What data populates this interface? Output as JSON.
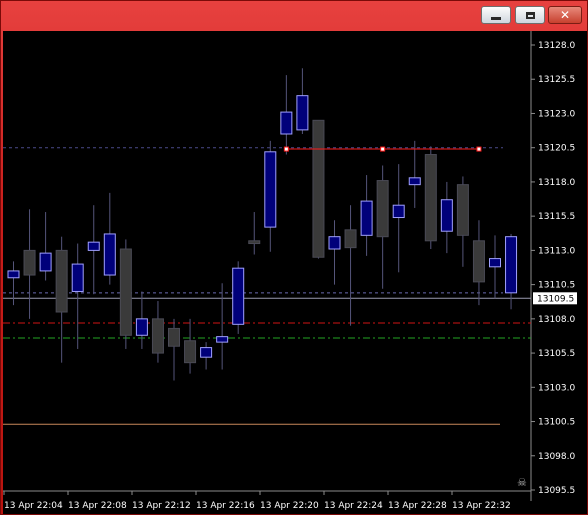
{
  "window": {
    "buttons": {
      "minimize": "minimize",
      "maximize": "maximize",
      "close": "close"
    }
  },
  "colors": {
    "background": "#000000",
    "axis": "#8c8c8c",
    "bull": "#00007a",
    "bear": "#3a3a3a",
    "wick": "#55557a",
    "ask_line": "#6a6ab0",
    "trendline": "#ff1a1a",
    "red_dash": "#d11414",
    "green_dash": "#25a325",
    "orange_line": "#c8875a"
  },
  "chart_data": {
    "type": "candlestick",
    "symbol_timeframe": "",
    "y_ticks": [
      "13128.0",
      "13125.5",
      "13123.0",
      "13120.5",
      "13118.0",
      "13115.5",
      "13113.0",
      "13110.5",
      "13108.0",
      "13105.5",
      "13103.0",
      "13100.5",
      "13098.0",
      "13095.5"
    ],
    "x_ticks": [
      "13 Apr 22:04",
      "13 Apr 22:08",
      "13 Apr 22:12",
      "13 Apr 22:16",
      "13 Apr 22:20",
      "13 Apr 22:24",
      "13 Apr 22:28",
      "13 Apr 22:32"
    ],
    "current_price_label": "13109.5",
    "ylim": [
      13095.0,
      13129.0
    ],
    "levels": {
      "bid": 13109.5,
      "ask": 13109.9,
      "upper_dotted": 13120.5,
      "red_dash": 13107.7,
      "green_dash": 13106.6,
      "orange": 13100.3
    },
    "trendline": {
      "from_index": 17,
      "to_index": 29,
      "price": 13120.4
    },
    "candles": [
      {
        "o": 13111.0,
        "h": 13112.2,
        "l": 13109.0,
        "c": 13111.5
      },
      {
        "o": 13113.0,
        "h": 13116.0,
        "l": 13108.0,
        "c": 13111.2
      },
      {
        "o": 13111.5,
        "h": 13115.8,
        "l": 13110.8,
        "c": 13112.8
      },
      {
        "o": 13113.0,
        "h": 13114.0,
        "l": 13104.8,
        "c": 13108.5
      },
      {
        "o": 13110.0,
        "h": 13113.5,
        "l": 13105.8,
        "c": 13112.0
      },
      {
        "o": 13113.0,
        "h": 13116.3,
        "l": 13109.8,
        "c": 13113.6
      },
      {
        "o": 13111.2,
        "h": 13117.2,
        "l": 13110.5,
        "c": 13114.2
      },
      {
        "o": 13113.1,
        "h": 13113.8,
        "l": 13105.8,
        "c": 13106.8
      },
      {
        "o": 13106.8,
        "h": 13110.0,
        "l": 13105.8,
        "c": 13108.0
      },
      {
        "o": 13108.0,
        "h": 13109.3,
        "l": 13104.8,
        "c": 13105.5
      },
      {
        "o": 13107.3,
        "h": 13108.0,
        "l": 13103.5,
        "c": 13106.0
      },
      {
        "o": 13106.4,
        "h": 13108.0,
        "l": 13104.0,
        "c": 13104.8
      },
      {
        "o": 13105.2,
        "h": 13106.3,
        "l": 13104.3,
        "c": 13105.9
      },
      {
        "o": 13106.3,
        "h": 13110.6,
        "l": 13104.3,
        "c": 13106.7
      },
      {
        "o": 13107.6,
        "h": 13112.2,
        "l": 13106.9,
        "c": 13111.7
      },
      {
        "o": 13113.7,
        "h": 13115.8,
        "l": 13112.7,
        "c": 13113.5
      },
      {
        "o": 13114.7,
        "h": 13121.0,
        "l": 13112.9,
        "c": 13120.2
      },
      {
        "o": 13121.5,
        "h": 13125.8,
        "l": 13120.0,
        "c": 13123.1
      },
      {
        "o": 13121.8,
        "h": 13126.3,
        "l": 13121.5,
        "c": 13124.3
      },
      {
        "o": 13122.5,
        "h": 13122.5,
        "l": 13112.4,
        "c": 13112.5
      },
      {
        "o": 13113.1,
        "h": 13115.2,
        "l": 13110.5,
        "c": 13114.0
      },
      {
        "o": 13114.5,
        "h": 13116.3,
        "l": 13107.5,
        "c": 13113.2
      },
      {
        "o": 13114.1,
        "h": 13118.5,
        "l": 13112.6,
        "c": 13116.6
      },
      {
        "o": 13118.1,
        "h": 13119.2,
        "l": 13110.2,
        "c": 13114.0
      },
      {
        "o": 13115.4,
        "h": 13119.3,
        "l": 13111.4,
        "c": 13116.3
      },
      {
        "o": 13117.8,
        "h": 13121.0,
        "l": 13116.1,
        "c": 13118.3
      },
      {
        "o": 13120.0,
        "h": 13120.6,
        "l": 13113.1,
        "c": 13113.7
      },
      {
        "o": 13114.4,
        "h": 13118.0,
        "l": 13112.8,
        "c": 13116.7
      },
      {
        "o": 13117.8,
        "h": 13118.4,
        "l": 13111.8,
        "c": 13114.1
      },
      {
        "o": 13113.7,
        "h": 13115.2,
        "l": 13109.0,
        "c": 13110.7
      },
      {
        "o": 13111.8,
        "h": 13114.1,
        "l": 13109.5,
        "c": 13112.4
      },
      {
        "o": 13109.9,
        "h": 13114.2,
        "l": 13108.7,
        "c": 13114.0
      }
    ]
  }
}
